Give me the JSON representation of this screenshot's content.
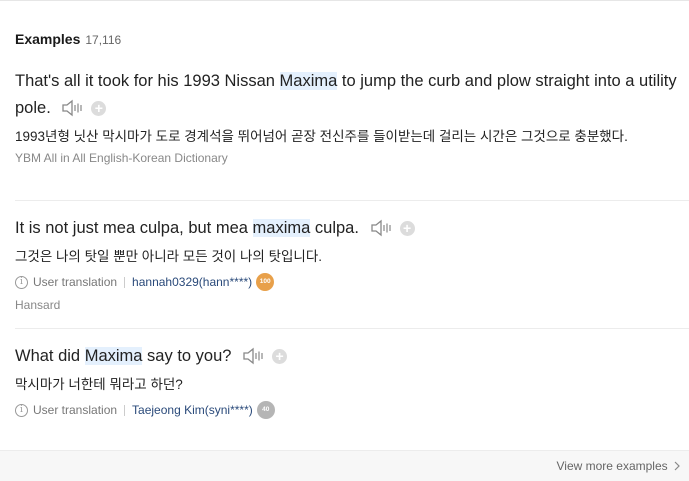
{
  "header": {
    "title": "Examples",
    "count": "17,116"
  },
  "examples": [
    {
      "en_pre": "That's all it took for his 1993 Nissan ",
      "en_hl": "Maxima",
      "en_post": " to jump the curb and plow straight into a utility pole.",
      "ko": "1993년형 닛산 막시마가 도로 경계석을 뛰어넘어 곧장 전신주를 들이받는데 걸리는 시간은 그것으로 충분했다.",
      "source": "YBM All in All English-Korean Dictionary"
    },
    {
      "en_pre": "It is not just mea culpa, but mea ",
      "en_hl": "maxima",
      "en_post": " culpa.",
      "ko": "그것은 나의 탓일 뿐만 아니라 모든 것이 나의 탓입니다.",
      "info_icon": "i",
      "meta_label": "User translation",
      "user": "hannah0329(hann****)",
      "badge": "100",
      "badge_color": "#e8a04a",
      "source": "Hansard"
    },
    {
      "en_pre": "What did ",
      "en_hl": "Maxima",
      "en_post": " say to you?",
      "ko": "막시마가 너한테 뭐라고 하던?",
      "info_icon": "i",
      "meta_label": "User translation",
      "user": "Taejeong Kim(syni****)",
      "badge": "40",
      "badge_color": "#b5b5b5"
    }
  ],
  "controls": {
    "plus_symbol": "+"
  },
  "icons": {
    "speaker": "speaker-icon",
    "add": "plus-icon",
    "info": "info-icon",
    "chevron": "chevron-right-icon"
  },
  "footer": {
    "more_label": "View more examples"
  }
}
